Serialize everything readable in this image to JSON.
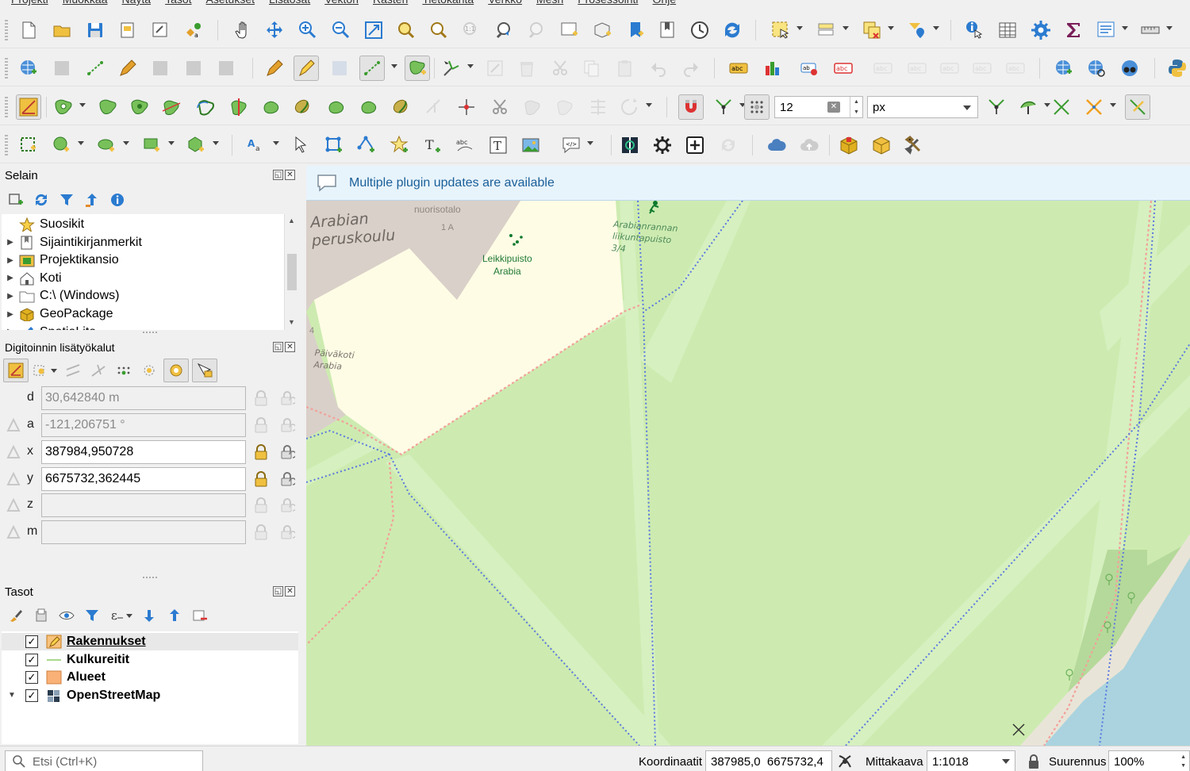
{
  "menu": [
    "Projekti",
    "Muokkaa",
    "Näytä",
    "Tasot",
    "Asetukset",
    "Lisäosat",
    "Vektori",
    "Rasteri",
    "Tietokanta",
    "Verkko",
    "Mesh",
    "Prosessointi",
    "Ohje"
  ],
  "snapping": {
    "tolerance": "12",
    "units": "px"
  },
  "browser": {
    "title": "Selain",
    "items": [
      {
        "label": "Suosikit",
        "icon": "star-icon",
        "expandable": false
      },
      {
        "label": "Sijaintikirjanmerkit",
        "icon": "bookmarks-icon",
        "expandable": true
      },
      {
        "label": "Projektikansio",
        "icon": "project-folder-icon",
        "expandable": true
      },
      {
        "label": "Koti",
        "icon": "home-icon",
        "expandable": true
      },
      {
        "label": "C:\\ (Windows)",
        "icon": "drive-folder-icon",
        "expandable": true
      },
      {
        "label": "GeoPackage",
        "icon": "geopackage-icon",
        "expandable": true
      },
      {
        "label": "SpatiaLite",
        "icon": "spatialite-icon",
        "expandable": true
      }
    ]
  },
  "digitizing": {
    "title": "Digitoinnin lisätyökalut",
    "fields": [
      {
        "label": "d",
        "value": "30,642840 m",
        "readonly": true
      },
      {
        "label": "a",
        "value": "-121,206751 °",
        "readonly": true
      },
      {
        "label": "x",
        "value": "387984,950728",
        "readonly": false
      },
      {
        "label": "y",
        "value": "6675732,362445",
        "readonly": false
      },
      {
        "label": "z",
        "value": "",
        "readonly": true
      },
      {
        "label": "m",
        "value": "",
        "readonly": true
      }
    ]
  },
  "layers": {
    "title": "Tasot",
    "items": [
      {
        "name": "Rakennukset",
        "checked": true,
        "symbol": "polygon-edit",
        "selected": true
      },
      {
        "name": "Kulkureitit",
        "checked": true,
        "symbol": "line"
      },
      {
        "name": "Alueet",
        "checked": true,
        "symbol": "polygon"
      },
      {
        "name": "OpenStreetMap",
        "checked": true,
        "symbol": "xyz-tiles"
      }
    ]
  },
  "message_bar": {
    "text": "Multiple plugin updates are available"
  },
  "map": {
    "labels": {
      "school": "Arabian\nperuskoulu",
      "nuoriso": "nuorisotalo",
      "nuoriso_code": "1 A",
      "park": "Leikkipuisto\nArabia",
      "sports": "Arabianrannan\nliikuntapuisto\n3/4",
      "daycare": "Päiväkoti\nArabia",
      "daycare_num": "4"
    },
    "colors": {
      "park": "#cdebb0",
      "building": "#d9d0c9",
      "school": "#fffce5",
      "water": "#aad3df",
      "footway": "#fa8072",
      "path": "#5a78e0"
    }
  },
  "statusbar": {
    "search_placeholder": "Etsi (Ctrl+K)",
    "coord_label": "Koordinaatit",
    "coord_value": "387985,0  6675732,4",
    "scale_label": "Mittakaava",
    "scale_value": "1:1018",
    "magnifier_label": "Suurennus",
    "magnifier_value": "100%"
  }
}
